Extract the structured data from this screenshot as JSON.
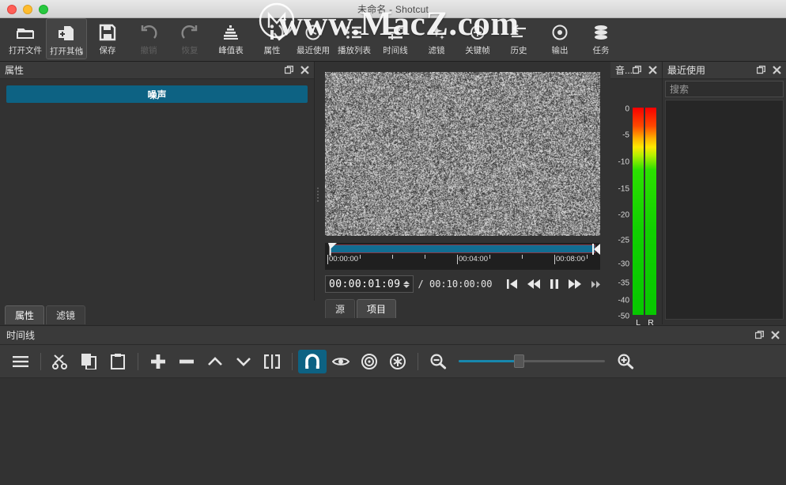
{
  "window": {
    "title": "未命名 - Shotcut",
    "traffic_lights": [
      "close",
      "minimize",
      "zoom"
    ]
  },
  "watermark": {
    "text": "www.MacZ.com",
    "logo": "macz-circle-m-logo"
  },
  "toolbar": {
    "items": [
      {
        "label": "打开文件",
        "icon": "open-folder-icon",
        "state": "normal"
      },
      {
        "label": "打开其他",
        "icon": "open-other-icon",
        "state": "active",
        "has_menu": true
      },
      {
        "label": "保存",
        "icon": "save-floppy-icon",
        "state": "normal"
      },
      {
        "label": "撤销",
        "icon": "undo-arrow-icon",
        "state": "disabled"
      },
      {
        "label": "恢复",
        "icon": "redo-arrow-icon",
        "state": "disabled"
      },
      {
        "label": "峰值表",
        "icon": "audio-peak-meter-icon",
        "state": "normal"
      },
      {
        "label": "属性",
        "icon": "info-properties-icon",
        "state": "normal"
      },
      {
        "label": "最近使用",
        "icon": "recent-clock-icon",
        "state": "normal"
      },
      {
        "label": "播放列表",
        "icon": "playlist-icon",
        "state": "normal"
      },
      {
        "label": "时间线",
        "icon": "timeline-icon",
        "state": "normal"
      },
      {
        "label": "滤镜",
        "icon": "filters-sparkle-icon",
        "state": "normal"
      },
      {
        "label": "关键帧",
        "icon": "keyframes-icon",
        "state": "normal"
      },
      {
        "label": "历史",
        "icon": "history-back-icon",
        "state": "normal"
      },
      {
        "label": "输出",
        "icon": "export-icon",
        "state": "normal"
      },
      {
        "label": "任务",
        "icon": "jobs-stack-icon",
        "state": "normal"
      }
    ]
  },
  "properties_panel": {
    "title": "属性",
    "header_bar_label": "噪声",
    "header_bar_color": "#0d6283",
    "float_icon": "float-panel-icon",
    "close_icon": "close-icon",
    "tabs": [
      {
        "label": "属性",
        "active": true
      },
      {
        "label": "滤镜",
        "active": false
      }
    ]
  },
  "player": {
    "video_content": "video-noise-static",
    "scrubber": {
      "ticks": [
        "00:00:00",
        "00:04:00",
        "00:08:00"
      ],
      "in_point": 0,
      "out_point": 100,
      "playhead_position_pct": 0.3
    },
    "timecode_current": "00:00:01:09",
    "timecode_separator": "/",
    "timecode_total": "00:10:00:00",
    "transport": [
      {
        "icon": "skip-to-start-icon",
        "name": "skip-to-start"
      },
      {
        "icon": "rewind-icon",
        "name": "rewind"
      },
      {
        "icon": "pause-icon",
        "name": "pause"
      },
      {
        "icon": "fast-forward-icon",
        "name": "fast-forward"
      },
      {
        "icon": "skip-to-next-icon",
        "name": "skip-next"
      }
    ],
    "tabs": [
      {
        "label": "源",
        "active": false
      },
      {
        "label": "项目",
        "active": true
      }
    ]
  },
  "audio_meter": {
    "title": "音...",
    "float_icon": "float-panel-icon",
    "close_icon": "close-icon",
    "scale": [
      "0",
      "-5",
      "-10",
      "-15",
      "-20",
      "-25",
      "-30",
      "-35",
      "-40",
      "-50"
    ],
    "channels": [
      "L",
      "R"
    ]
  },
  "recent_panel": {
    "title": "最近使用",
    "float_icon": "float-panel-icon",
    "close_icon": "close-icon",
    "search_placeholder": "搜索",
    "items": []
  },
  "timeline_panel": {
    "title": "时间线",
    "float_icon": "float-panel-icon",
    "close_icon": "close-icon",
    "tools": [
      {
        "name": "timeline-menu",
        "icon": "hamburger-menu-icon",
        "active": false
      },
      {
        "name": "cut",
        "icon": "scissors-icon",
        "active": false
      },
      {
        "name": "copy",
        "icon": "copy-icon",
        "active": false
      },
      {
        "name": "paste",
        "icon": "clipboard-paste-icon",
        "active": false
      },
      {
        "name": "append",
        "icon": "plus-icon",
        "active": false
      },
      {
        "name": "ripple-delete",
        "icon": "minus-icon",
        "active": false
      },
      {
        "name": "lift",
        "icon": "chevron-up-icon",
        "active": false
      },
      {
        "name": "overwrite",
        "icon": "chevron-down-icon",
        "active": false
      },
      {
        "name": "split",
        "icon": "split-icon",
        "active": false
      },
      {
        "name": "snap",
        "icon": "magnet-icon",
        "active": true
      },
      {
        "name": "scrub-while-dragging",
        "icon": "eye-scrub-icon",
        "active": false
      },
      {
        "name": "ripple",
        "icon": "ripple-target-icon",
        "active": false
      },
      {
        "name": "ripple-all-tracks",
        "icon": "ripple-all-asterisk-icon",
        "active": false
      }
    ],
    "zoom_out_icon": "zoom-out-icon",
    "zoom_in_icon": "zoom-in-icon",
    "zoom_value_pct": 41
  },
  "colors": {
    "accent": "#0d6283",
    "slider_fill": "#1787ad",
    "panel_bg": "#323232",
    "toolbar_bg": "#3a3a3a",
    "text": "#e2e2e2"
  }
}
